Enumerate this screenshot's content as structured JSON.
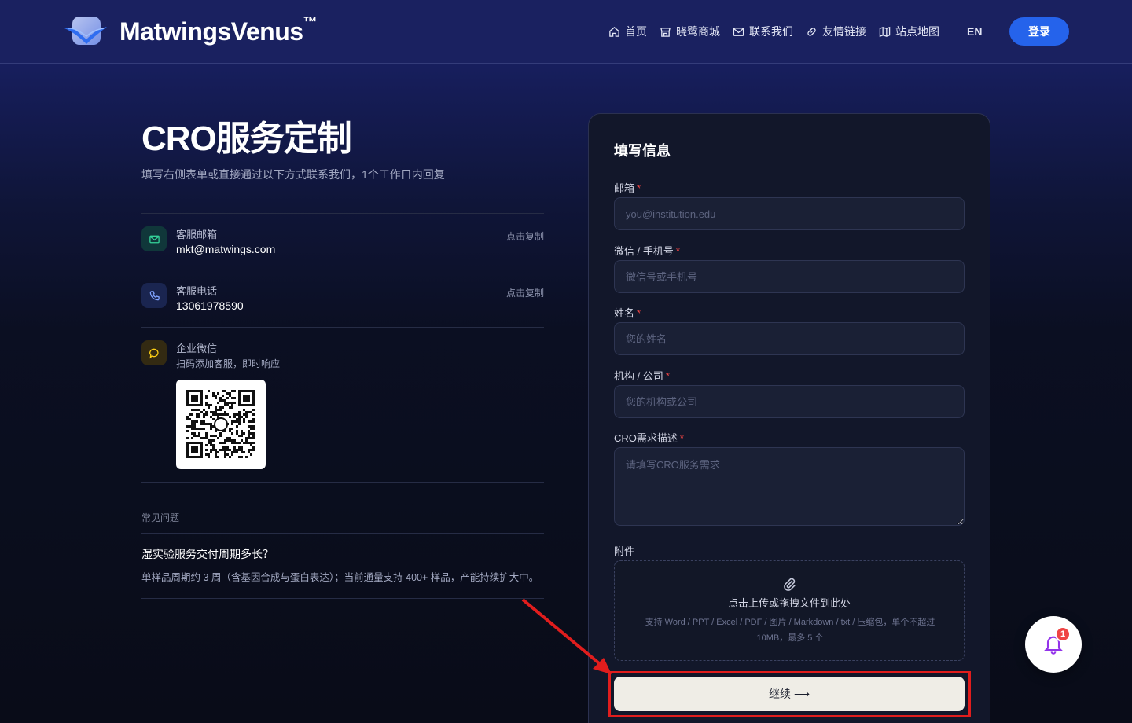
{
  "header": {
    "brand": "MatwingsVenus",
    "brand_tm": "™",
    "nav": [
      {
        "label": "首页",
        "icon": "home-icon"
      },
      {
        "label": "晓鹭商城",
        "icon": "store-icon"
      },
      {
        "label": "联系我们",
        "icon": "mail-icon"
      },
      {
        "label": "友情链接",
        "icon": "link-icon"
      },
      {
        "label": "站点地图",
        "icon": "map-icon"
      }
    ],
    "lang": "EN",
    "login": "登录"
  },
  "hero": {
    "title": "CRO服务定制",
    "subtitle": "填写右侧表单或直接通过以下方式联系我们，1个工作日内回复"
  },
  "contacts": {
    "email": {
      "label": "客服邮箱",
      "value": "mkt@matwings.com",
      "copy": "点击复制"
    },
    "phone": {
      "label": "客服电话",
      "value": "13061978590",
      "copy": "点击复制"
    },
    "wechat": {
      "label": "企业微信",
      "desc": "扫码添加客服，即时响应"
    }
  },
  "faq": {
    "heading": "常见问题",
    "question": "湿实验服务交付周期多长？",
    "answer": "单样品周期约 3 周（含基因合成与蛋白表达）；当前通量支持 400+ 样品，产能持续扩大中。"
  },
  "form": {
    "title": "填写信息",
    "required_mark": "*",
    "fields": {
      "email": {
        "label": "邮箱",
        "placeholder": "you@institution.edu"
      },
      "wechat": {
        "label": "微信 / 手机号",
        "placeholder": "微信号或手机号"
      },
      "name": {
        "label": "姓名",
        "placeholder": "您的姓名"
      },
      "org": {
        "label": "机构 / 公司",
        "placeholder": "您的机构或公司"
      },
      "desc": {
        "label": "CRO需求描述",
        "placeholder": "请填写CRO服务需求"
      }
    },
    "attachment": {
      "label": "附件",
      "main": "点击上传或拖拽文件到此处",
      "hint": "支持 Word / PPT / Excel / PDF / 图片 / Markdown / txt / 压缩包，单个不超过 10MB，最多 5 个"
    },
    "submit": "继续 ⟶"
  },
  "notification": {
    "count": "1"
  },
  "colors": {
    "accent": "#2563eb",
    "highlight": "#e11d1d",
    "required": "#ef4444"
  }
}
